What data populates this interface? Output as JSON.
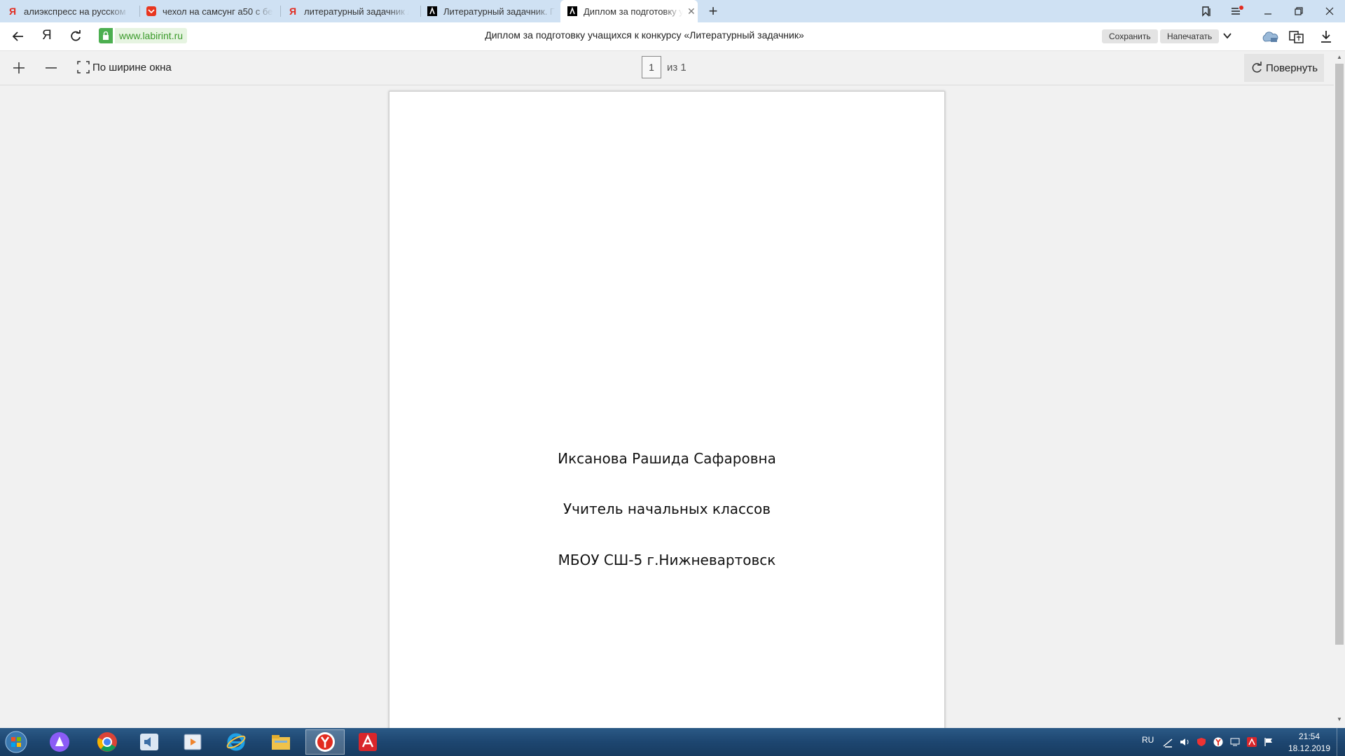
{
  "browser": {
    "tabs": [
      {
        "title": "алиэкспресс на русском —",
        "favicon": "yandex-icon",
        "favicon_color": "#e22b1f"
      },
      {
        "title": "чехол на самсунг а50 с бесп",
        "favicon": "mail-icon",
        "favicon_color": "#e8361f"
      },
      {
        "title": "литературный задачник ла",
        "favicon": "yandex-icon",
        "favicon_color": "#e22b1f"
      },
      {
        "title": "Литературный задачник. Г",
        "favicon": "labirint-icon",
        "favicon_color": "#000000"
      },
      {
        "title": "Диплом за подготовку у",
        "favicon": "labirint-icon",
        "favicon_color": "#000000",
        "active": true
      }
    ],
    "address": {
      "domain": "www.labirint.ru",
      "page_title": "Диплом за подготовку учащихся к конкурсу «Литературный задачник»",
      "save_label": "Сохранить",
      "print_label": "Напечатать"
    }
  },
  "pdf_toolbar": {
    "fit_label": "По ширине окна",
    "page_current": "1",
    "page_total_label": "из 1",
    "rotate_label": "Повернуть"
  },
  "document": {
    "name_line": "Иксанова Рашида Сафаровна",
    "role_line": "Учитель начальных классов",
    "school_line": "МБОУ СШ-5 г.Нижневартовск"
  },
  "taskbar": {
    "language": "RU",
    "time": "21:54",
    "date": "18.12.2019"
  },
  "colors": {
    "tabbar_bg": "#cfe1f3",
    "domain_green": "#3a9a2a",
    "lock_bg": "#4caf50",
    "taskbar_bg": "#1d4670"
  }
}
